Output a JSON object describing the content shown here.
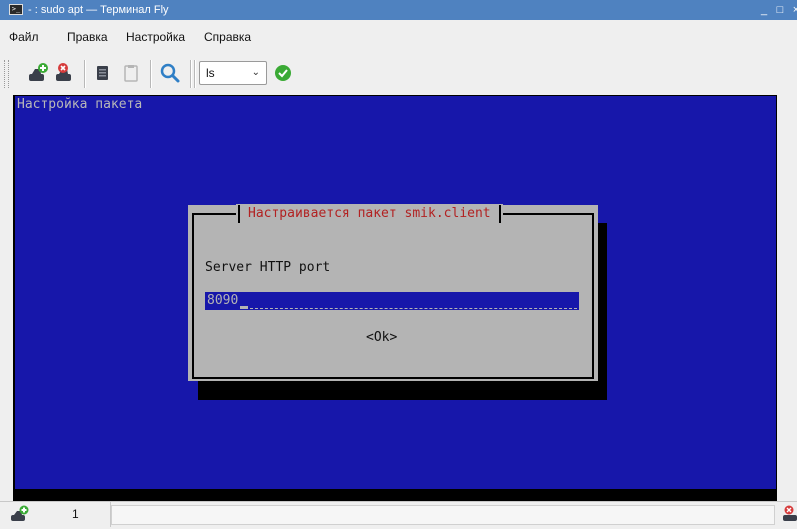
{
  "window": {
    "title": "- : sudo apt — Терминал Fly",
    "minimize_glyph": "_",
    "maximize_glyph": "□",
    "close_glyph": "×"
  },
  "menu": {
    "items": [
      {
        "label": "Файл"
      },
      {
        "label": "Правка"
      },
      {
        "label": "Настройка"
      },
      {
        "label": "Справка"
      }
    ]
  },
  "toolbar": {
    "command_combo_value": "ls",
    "icons": [
      "new-session-icon",
      "close-session-icon",
      "copy-icon",
      "paste-icon",
      "search-icon",
      "run-command-icon"
    ]
  },
  "terminal": {
    "header_text": "Настройка пакета",
    "dialog": {
      "title": "Настраивается пакет smik.client",
      "prompt": "Server HTTP port",
      "input_value": "8090",
      "ok_label": "<Ok>"
    },
    "colors": {
      "background": "#1717aa",
      "dialog_bg": "#b4b4b4",
      "title_red": "#b22222"
    }
  },
  "tabs": [
    {
      "label": "1"
    }
  ],
  "accent_color": "#4f82c0"
}
